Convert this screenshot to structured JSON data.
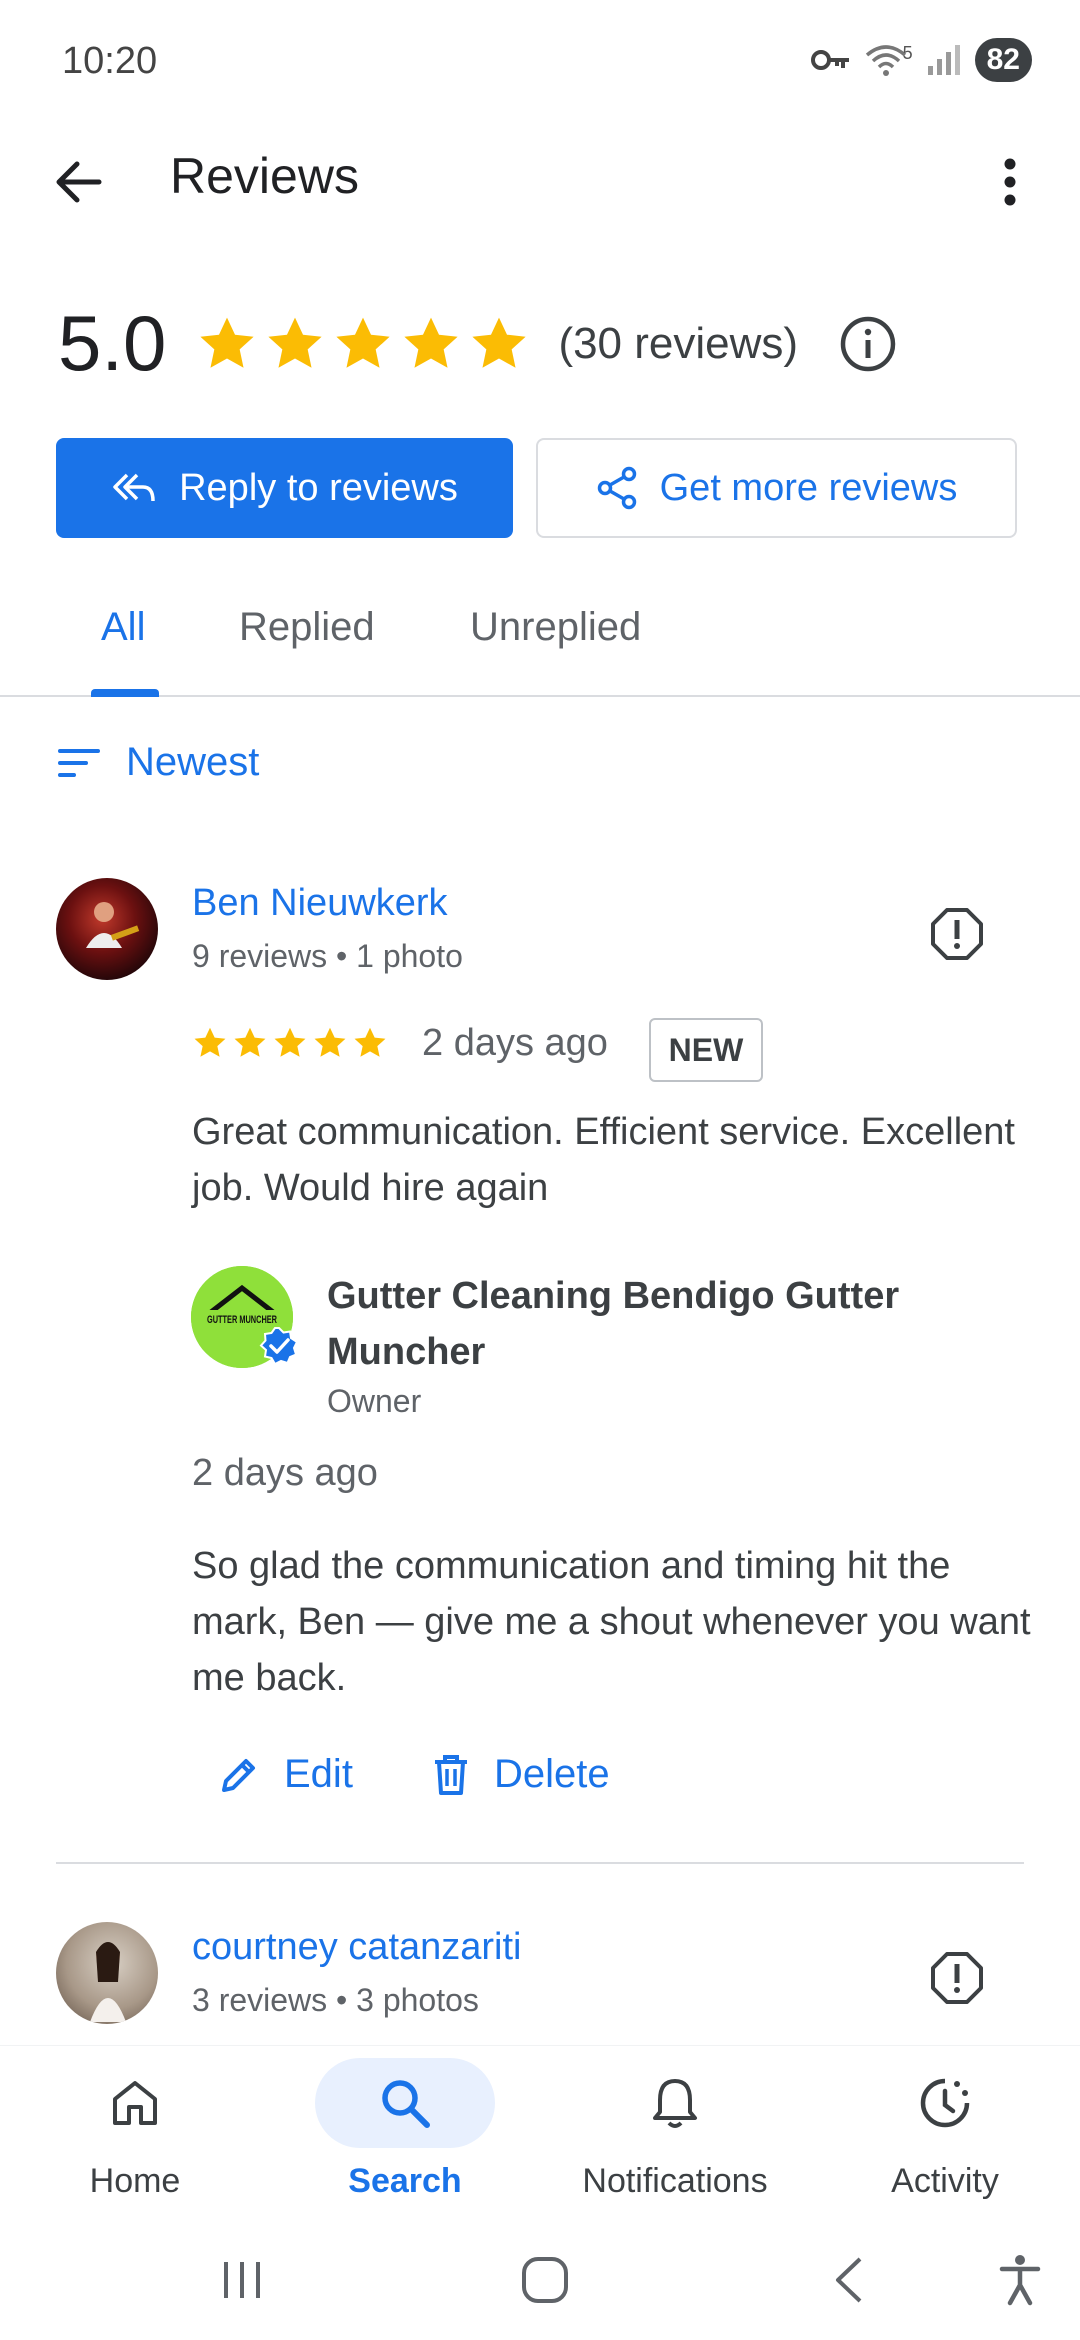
{
  "status_bar": {
    "time": "10:20",
    "battery": "82",
    "wifi_label": "5"
  },
  "appbar": {
    "title": "Reviews"
  },
  "summary": {
    "score": "5.0",
    "stars": 5,
    "count_text": "(30 reviews)"
  },
  "actions": {
    "reply_label": "Reply to reviews",
    "more_label": "Get more reviews"
  },
  "tabs": [
    {
      "label": "All",
      "active": true
    },
    {
      "label": "Replied",
      "active": false
    },
    {
      "label": "Unreplied",
      "active": false
    }
  ],
  "sort": {
    "label": "Newest"
  },
  "reviews": [
    {
      "name": "Ben Nieuwkerk",
      "meta": "9 reviews • 1 photo",
      "stars": 5,
      "date": "2 days ago",
      "badge": "NEW",
      "text": "Great communication. Efficient service. Excellent job. Would hire again",
      "reply": {
        "owner_name": "Gutter Cleaning Bendigo Gutter Muncher",
        "owner_role": "Owner",
        "owner_logo_text": "GUTTER MUNCHER",
        "date": "2 days ago",
        "text": "So glad the communication and timing hit the mark, Ben — give me a shout whenever you want me back."
      },
      "edit_label": "Edit",
      "delete_label": "Delete"
    },
    {
      "name": "courtney catanzariti",
      "meta": "3 reviews • 3 photos"
    }
  ],
  "bottom_nav": [
    {
      "label": "Home",
      "icon": "home-icon",
      "active": false
    },
    {
      "label": "Search",
      "icon": "search-icon",
      "active": true
    },
    {
      "label": "Notifications",
      "icon": "bell-icon",
      "active": false
    },
    {
      "label": "Activity",
      "icon": "activity-icon",
      "active": false
    }
  ],
  "colors": {
    "accent": "#1a73e8",
    "star": "#fbbc04",
    "text": "#202124",
    "muted": "#5f6368"
  }
}
